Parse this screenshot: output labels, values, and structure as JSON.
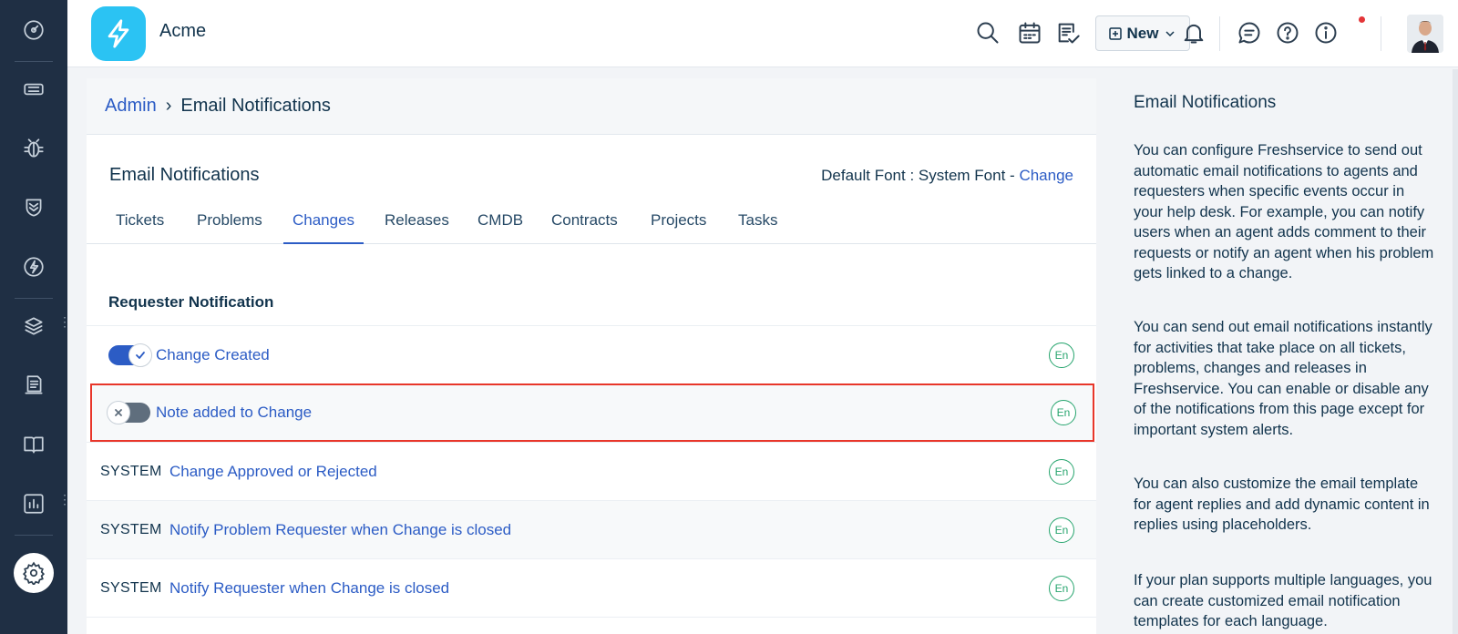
{
  "header": {
    "org_name": "Acme",
    "new_button_label": "New",
    "icons": [
      "search-icon",
      "calendar-icon",
      "todo-icon",
      "bell-icon",
      "chat-icon",
      "help-icon",
      "info-icon"
    ]
  },
  "sidebar": {
    "items": [
      "dashboard-icon",
      "tickets-icon",
      "problems-icon",
      "changes-icon",
      "releases-icon",
      "assets-icon",
      "contracts-icon",
      "solutions-icon",
      "reports-icon",
      "admin-settings-icon"
    ]
  },
  "breadcrumb": {
    "parent": "Admin",
    "current": "Email Notifications"
  },
  "page": {
    "title": "Email Notifications",
    "default_font_label": "Default Font : System Font - ",
    "change_link": "Change"
  },
  "tabs": [
    {
      "label": "Tickets"
    },
    {
      "label": "Problems"
    },
    {
      "label": "Changes",
      "active": true
    },
    {
      "label": "Releases"
    },
    {
      "label": "CMDB"
    },
    {
      "label": "Contracts"
    },
    {
      "label": "Projects"
    },
    {
      "label": "Tasks"
    }
  ],
  "group": {
    "title": "Requester Notification",
    "rows": [
      {
        "type": "toggle",
        "state": "on",
        "label": "Change Created",
        "lang": "En"
      },
      {
        "type": "toggle",
        "state": "off",
        "label": "Note added to Change",
        "lang": "En"
      },
      {
        "type": "system",
        "tag": "SYSTEM",
        "label": "Change Approved or Rejected",
        "lang": "En"
      },
      {
        "type": "system",
        "tag": "SYSTEM",
        "label": "Notify Problem Requester when Change is closed",
        "lang": "En"
      },
      {
        "type": "system",
        "tag": "SYSTEM",
        "label": "Notify Requester when Change is closed",
        "lang": "En"
      }
    ]
  },
  "help": {
    "title": "Email Notifications",
    "paragraphs": [
      "You can configure Freshservice to send out automatic email notifications to agents and requesters when specific events occur in your help desk. For example, you can notify users when an agent adds comment to their requests or notify an agent when his problem gets linked to a change.",
      "You can send out email notifications instantly for activities that take place on all tickets, problems, changes and releases in Freshservice. You can enable or disable any of the notifications from this page except for important system alerts.",
      "You can also customize the email template for agent replies and add dynamic content in replies using placeholders.",
      "If your plan supports multiple languages, you can create customized email notification templates for each language."
    ]
  },
  "colors": {
    "sidebar_bg": "#1f2f44",
    "link_blue": "#2c5cc5",
    "lang_green": "#27a56e",
    "highlight_red": "#e8362a",
    "logo_cyan": "#2bc3f3"
  }
}
